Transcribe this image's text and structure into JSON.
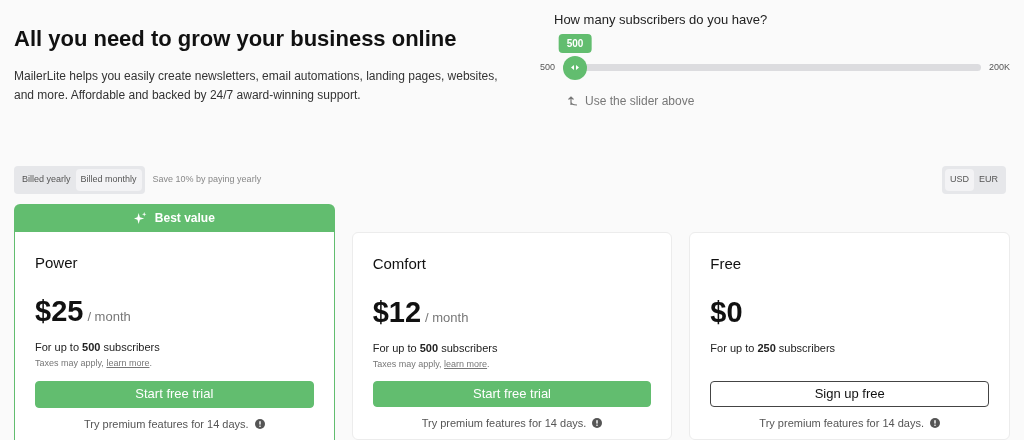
{
  "heading": "All you need to grow your business online",
  "intro": "MailerLite helps you easily create newsletters, email automations, landing pages, websites, and more. Affordable and backed by 24/7 award-winning support.",
  "slider": {
    "question": "How many subscribers do you have?",
    "value": "500",
    "min_label": "500",
    "max_label": "200K",
    "level": 0,
    "hint": "Use the slider above"
  },
  "billing": [
    {
      "label": "Billed yearly",
      "selected": false
    },
    {
      "label": "Billed monthly",
      "selected": true
    }
  ],
  "billing_note": "Save 10% by paying yearly",
  "currencies": [
    {
      "label": "USD",
      "selected": true
    },
    {
      "label": "EUR",
      "selected": false
    }
  ],
  "plans": [
    {
      "name": "Power",
      "badge": "Best value",
      "price": "$25",
      "period": "/ month",
      "subscribers": "For up to **500** subscribers",
      "taxes": "Taxes may apply,",
      "taxes_link": "learn more",
      "taxes_end": ".",
      "button": {
        "label": "Start free trial",
        "kind": "primary"
      },
      "trial_note": "Try premium features for 14 days."
    },
    {
      "name": "Comfort",
      "price": "$12",
      "period": "/ month",
      "subscribers": "For up to **500** subscribers",
      "taxes": "Taxes may apply,",
      "taxes_link": "learn more",
      "taxes_end": ".",
      "button": {
        "label": "Start free trial",
        "kind": "primary"
      },
      "trial_note": "Try premium features for 14 days."
    },
    {
      "name": "Free",
      "price": "$0",
      "subscribers": "For up to **250** subscribers",
      "button": {
        "label": "Sign up free",
        "kind": "outline"
      },
      "trial_note": "Try premium features for 14 days."
    }
  ]
}
